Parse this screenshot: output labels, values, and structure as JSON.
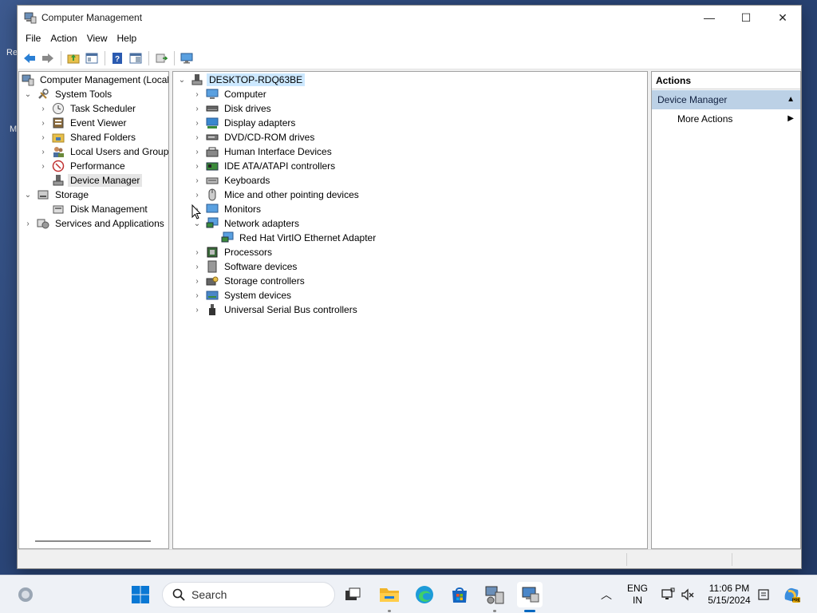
{
  "window": {
    "title": "Computer Management",
    "minimize_glyph": "—",
    "maximize_glyph": "☐",
    "close_glyph": "✕"
  },
  "menu": [
    "File",
    "Action",
    "View",
    "Help"
  ],
  "toolbar": {
    "buttons": [
      "back-icon",
      "forward-icon",
      "up-folder-icon",
      "show-hide-tree-icon",
      "help-icon",
      "properties-icon",
      "export-icon",
      "monitor-icon"
    ]
  },
  "left_tree": {
    "root": "Computer Management (Local",
    "system_tools": "System Tools",
    "task_scheduler": "Task Scheduler",
    "event_viewer": "Event Viewer",
    "shared_folders": "Shared Folders",
    "local_users": "Local Users and Groups",
    "performance": "Performance",
    "device_manager": "Device Manager",
    "storage": "Storage",
    "disk_management": "Disk Management",
    "services_apps": "Services and Applications"
  },
  "device_tree": {
    "root": "DESKTOP-RDQ63BE",
    "categories": [
      {
        "label": "Computer",
        "icon": "computer-icon",
        "expanded": false
      },
      {
        "label": "Disk drives",
        "icon": "disk-drive-icon",
        "expanded": false
      },
      {
        "label": "Display adapters",
        "icon": "display-adapter-icon",
        "expanded": false
      },
      {
        "label": "DVD/CD-ROM drives",
        "icon": "dvd-drive-icon",
        "expanded": false
      },
      {
        "label": "Human Interface Devices",
        "icon": "hid-icon",
        "expanded": false
      },
      {
        "label": "IDE ATA/ATAPI controllers",
        "icon": "ide-controller-icon",
        "expanded": false
      },
      {
        "label": "Keyboards",
        "icon": "keyboard-icon",
        "expanded": false
      },
      {
        "label": "Mice and other pointing devices",
        "icon": "mouse-icon",
        "expanded": false
      },
      {
        "label": "Monitors",
        "icon": "monitor-icon",
        "expanded": false
      },
      {
        "label": "Network adapters",
        "icon": "network-adapter-icon",
        "expanded": true
      },
      {
        "label": "Red Hat VirtIO Ethernet Adapter",
        "icon": "network-adapter-icon",
        "child": true
      },
      {
        "label": "Processors",
        "icon": "processor-icon",
        "expanded": false
      },
      {
        "label": "Software devices",
        "icon": "software-device-icon",
        "expanded": false
      },
      {
        "label": "Storage controllers",
        "icon": "storage-controller-icon",
        "expanded": false
      },
      {
        "label": "System devices",
        "icon": "system-device-icon",
        "expanded": false
      },
      {
        "label": "Universal Serial Bus controllers",
        "icon": "usb-icon",
        "expanded": false
      }
    ]
  },
  "actions": {
    "header": "Actions",
    "section": "Device Manager",
    "more": "More Actions"
  },
  "taskbar": {
    "search_placeholder": "Search",
    "lang_line1": "ENG",
    "lang_line2": "IN",
    "time": "11:06 PM",
    "date": "5/15/2024"
  },
  "colors": {
    "selection": "#cce8ff",
    "actions_section_bg": "#bcd1e6",
    "accent": "#0067c0"
  }
}
